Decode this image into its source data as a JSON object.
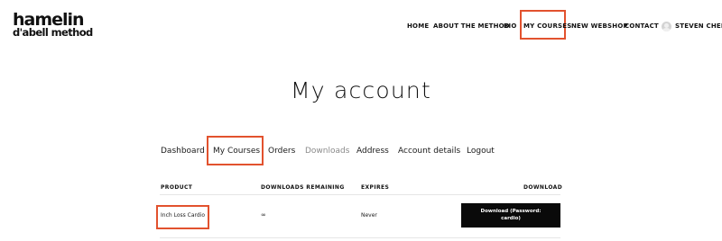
{
  "brand": {
    "logo_main": "hamelin",
    "logo_sub": "d'abell method"
  },
  "nav": {
    "home": "HOME",
    "about": "ABOUT THE METHOD",
    "bio": "BIO",
    "my_courses": "MY COURSES",
    "webshop": "NEW WEBSHOP",
    "contact": "CONTACT",
    "user": "STEVEN CHENG"
  },
  "page": {
    "title": "My account"
  },
  "tabs": {
    "dashboard": "Dashboard",
    "my_courses": "My Courses",
    "orders": "Orders",
    "downloads": "Downloads",
    "address": "Address",
    "account_details": "Account details",
    "logout": "Logout"
  },
  "table": {
    "headers": {
      "product": "PRODUCT",
      "remaining": "DOWNLOADS REMAINING",
      "expires": "EXPIRES",
      "download": "DOWNLOAD"
    },
    "rows": [
      {
        "product": "Inch Loss Cardio",
        "remaining": "∞",
        "expires": "Never",
        "download": "Download (Password: cardio)"
      }
    ]
  },
  "colors": {
    "highlight": "#e2522e",
    "button_bg": "#0a0a0a",
    "muted_text": "#8a8a8a"
  }
}
